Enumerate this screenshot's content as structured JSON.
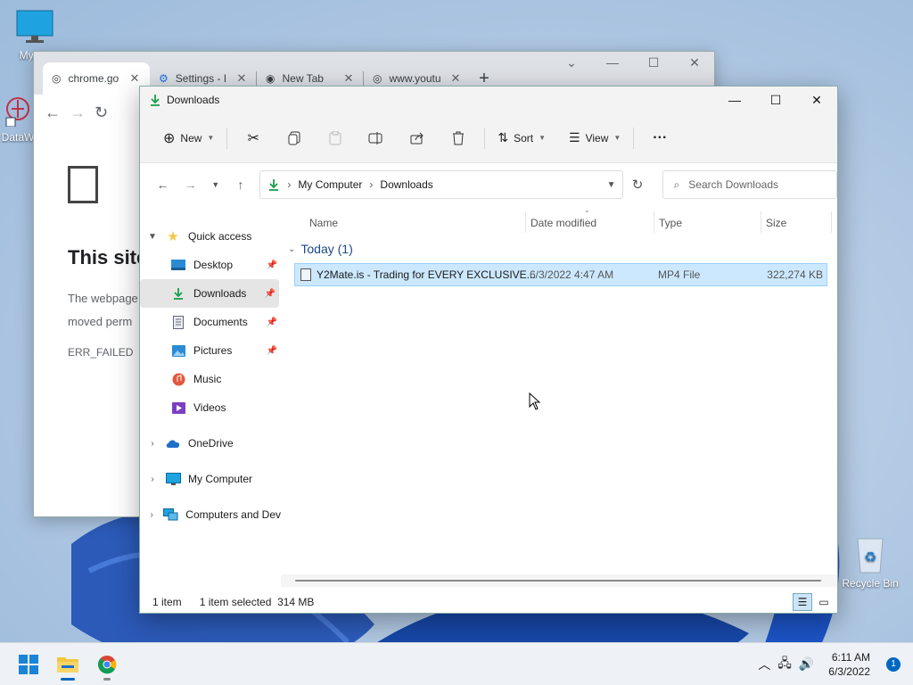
{
  "desktop": {
    "icons": [
      {
        "label": "My Co",
        "icon": "monitor-icon"
      },
      {
        "label": "DataW",
        "icon": "datawrapper-icon"
      }
    ],
    "recycle_bin": "Recycle Bin"
  },
  "chrome": {
    "tabs": [
      {
        "title": "chrome.go",
        "icon": "globe-icon",
        "active": true
      },
      {
        "title": "Settings - I",
        "icon": "gear-icon",
        "active": false
      },
      {
        "title": "New Tab",
        "icon": "chrome-icon",
        "active": false
      },
      {
        "title": "www.youtu",
        "icon": "globe-icon",
        "active": false
      }
    ],
    "page": {
      "title": "This site",
      "desc_line1": "The webpage",
      "desc_line2": "moved perm",
      "error_code": "ERR_FAILED"
    }
  },
  "explorer": {
    "title": "Downloads",
    "commands": {
      "new": "New",
      "sort": "Sort",
      "view": "View"
    },
    "address": {
      "crumbs": [
        "My Computer",
        "Downloads"
      ]
    },
    "search_placeholder": "Search Downloads",
    "nav": {
      "quick_access": "Quick access",
      "items": [
        {
          "label": "Desktop",
          "pinned": true
        },
        {
          "label": "Downloads",
          "pinned": true
        },
        {
          "label": "Documents",
          "pinned": true
        },
        {
          "label": "Pictures",
          "pinned": true
        },
        {
          "label": "Music",
          "pinned": false
        },
        {
          "label": "Videos",
          "pinned": false
        }
      ],
      "onedrive": "OneDrive",
      "my_computer": "My Computer",
      "computers": "Computers and Dev"
    },
    "columns": {
      "name": "Name",
      "date": "Date modified",
      "type": "Type",
      "size": "Size"
    },
    "group": "Today (1)",
    "files": [
      {
        "name": "Y2Mate.is - Trading for EVERY EXCLUSIVE...",
        "date": "6/3/2022 4:47 AM",
        "type": "MP4 File",
        "size": "322,274 KB"
      }
    ],
    "status": {
      "count": "1 item",
      "selected": "1 item selected  314 MB"
    }
  },
  "taskbar": {
    "time": "6:11 AM",
    "date": "6/3/2022",
    "notifications": "1"
  },
  "colors": {
    "accent": "#0067c0",
    "selection": "#cce8ff",
    "folder_yellow": "#f2c744"
  }
}
